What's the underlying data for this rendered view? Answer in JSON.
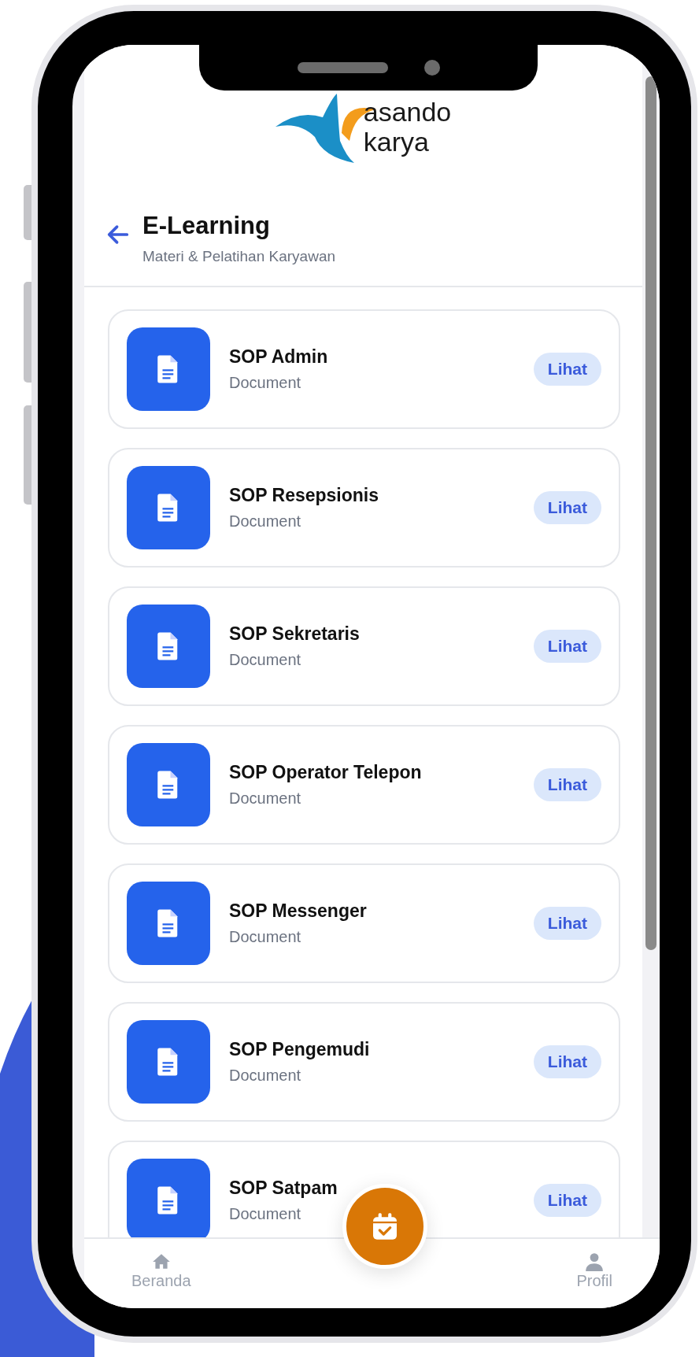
{
  "logo": {
    "line_1": "asando",
    "line_2": "karya"
  },
  "header": {
    "title": "E-Learning",
    "subtitle": "Materi & Pelatihan Karyawan"
  },
  "materials": [
    {
      "title": "SOP Admin",
      "type": "Document",
      "action": "Lihat"
    },
    {
      "title": "SOP Resepsionis",
      "type": "Document",
      "action": "Lihat"
    },
    {
      "title": "SOP Sekretaris",
      "type": "Document",
      "action": "Lihat"
    },
    {
      "title": "SOP Operator Telepon",
      "type": "Document",
      "action": "Lihat"
    },
    {
      "title": "SOP Messenger",
      "type": "Document",
      "action": "Lihat"
    },
    {
      "title": "SOP Pengemudi",
      "type": "Document",
      "action": "Lihat"
    },
    {
      "title": "SOP Satpam",
      "type": "Document",
      "action": "Lihat"
    }
  ],
  "bottom_nav": {
    "items": [
      {
        "kind": "home",
        "label": "Beranda"
      },
      {
        "kind": "fab"
      },
      {
        "kind": "profile",
        "label": "Profil"
      }
    ]
  }
}
